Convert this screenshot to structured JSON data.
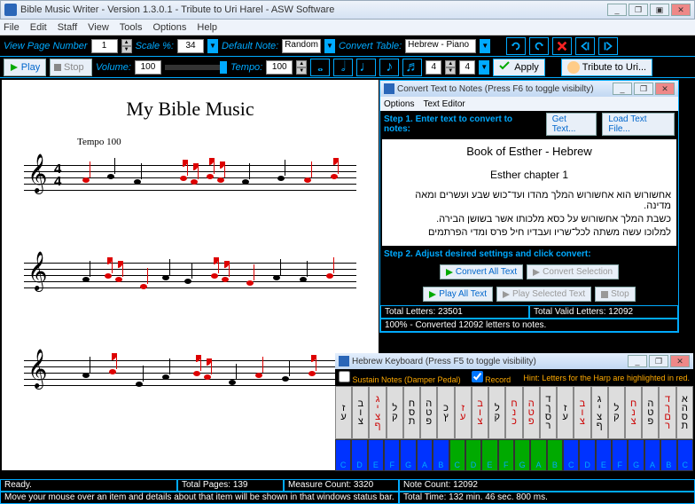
{
  "window": {
    "title": "Bible Music Writer - Version 1.3.0.1 - Tribute to Uri Harel    -    ASW Software"
  },
  "menu": [
    "File",
    "Edit",
    "Staff",
    "View",
    "Tools",
    "Options",
    "Help"
  ],
  "toolbar1": {
    "view_page_label": "View Page Number",
    "page": "1",
    "scale_label": "Scale %:",
    "scale": "34",
    "default_note_label": "Default Note:",
    "default_note": "Random",
    "convert_table_label": "Convert Table:",
    "convert_table": "Hebrew - Piano"
  },
  "toolbar2": {
    "play": "Play",
    "stop": "Stop",
    "volume_label": "Volume:",
    "volume": "100",
    "tempo_label": "Tempo:",
    "tempo": "100",
    "timesig_num": "4",
    "timesig_den": "4",
    "apply": "Apply",
    "tribute": "Tribute to Uri..."
  },
  "score": {
    "title": "My Bible Music",
    "tempo_mark": "Tempo 100",
    "timesig": {
      "num": "4",
      "den": "4"
    }
  },
  "convert_dialog": {
    "title": "Convert Text to Notes (Press F6 to toggle visibilty)",
    "menu": [
      "Options",
      "Text Editor"
    ],
    "step1": "Step 1. Enter text to convert to notes:",
    "get_text": "Get Text...",
    "load_file": "Load Text File...",
    "heading": "Book of Esther - Hebrew",
    "chapter": "Esther chapter 1",
    "line1": "אחשורוש הוא אחשורוש המלך מהדו ועד־כוש שבע ועשרים ומאה מדינה.",
    "line2": "כשבת המלך אחשורוש על כסא מלכותו אשר בשושן הבירה.",
    "line3": "למלוכו עשה משתה לכל־שריו ועבדיו חיל פרס ומדי הפרתמים",
    "step2": "Step 2. Adjust desired settings and click convert:",
    "convert_all": "Convert All Text",
    "convert_sel": "Convert Selection",
    "play_all": "Play All Text",
    "play_sel": "Play Selected Text",
    "stop": "Stop",
    "total_letters": "Total Letters: 23501",
    "valid_letters": "Total Valid Letters: 12092",
    "progress": "100% - Converted 12092 letters to notes."
  },
  "keyboard_dialog": {
    "title": "Hebrew Keyboard (Press F5 to toggle visibility)",
    "sustain": "Sustain Notes (Damper Pedal)",
    "record": "Record",
    "hint": "Hint: Letters for the Harp are highlighted in red.",
    "cols": [
      {
        "h": [
          "ז",
          "ע"
        ],
        "red": false
      },
      {
        "h": [
          "ב",
          "ו",
          "צ"
        ],
        "red": false
      },
      {
        "h": [
          "ג",
          "י",
          "צ",
          "ף"
        ],
        "red": true
      },
      {
        "h": [
          "ל",
          "ק"
        ],
        "red": false
      },
      {
        "h": [
          "ח",
          "ס",
          "ת"
        ],
        "red": false
      },
      {
        "h": [
          "ה",
          "ט",
          "פ"
        ],
        "red": false
      },
      {
        "h": [
          "כ",
          "ץ"
        ],
        "red": false
      },
      {
        "h": [
          "ז",
          "ע"
        ],
        "red": true
      },
      {
        "h": [
          "ב",
          "ו",
          "צ"
        ],
        "red": true
      },
      {
        "h": [
          "ל",
          "ק"
        ],
        "red": false
      },
      {
        "h": [
          "ח",
          "נ",
          "כ"
        ],
        "red": true
      },
      {
        "h": [
          "ה",
          "ט",
          "פ"
        ],
        "red": true
      },
      {
        "h": [
          "ד",
          "ך",
          "ס",
          "ר"
        ],
        "red": false
      },
      {
        "h": [
          "ז",
          "ע"
        ],
        "red": false
      },
      {
        "h": [
          "ב",
          "ו",
          "צ"
        ],
        "red": true
      },
      {
        "h": [
          "ג",
          "י",
          "צ",
          "ף"
        ],
        "red": false
      },
      {
        "h": [
          "ל",
          "ק"
        ],
        "red": false
      },
      {
        "h": [
          "ח",
          "נ",
          "צ"
        ],
        "red": true
      },
      {
        "h": [
          "ה",
          "ט",
          "פ"
        ],
        "red": false
      },
      {
        "h": [
          "ד",
          "ך",
          "ם",
          "ר"
        ],
        "red": true
      },
      {
        "h": [
          "א",
          "ה",
          "ס",
          "ת"
        ],
        "red": false
      }
    ],
    "piano": [
      "C",
      "D",
      "E",
      "F",
      "G",
      "A",
      "B",
      "C",
      "D",
      "E",
      "F",
      "G",
      "A",
      "B",
      "C",
      "D",
      "E",
      "F",
      "G",
      "A",
      "B",
      "C"
    ]
  },
  "status": {
    "ready": "Ready.",
    "pages": "Total Pages: 139",
    "measures": "Measure Count: 3320",
    "notes": "Note Count: 12092",
    "hint": "Move your mouse over an item and details about that item will be shown in that windows status bar.",
    "time": "Total Time: 132 min. 46 sec. 800 ms."
  }
}
